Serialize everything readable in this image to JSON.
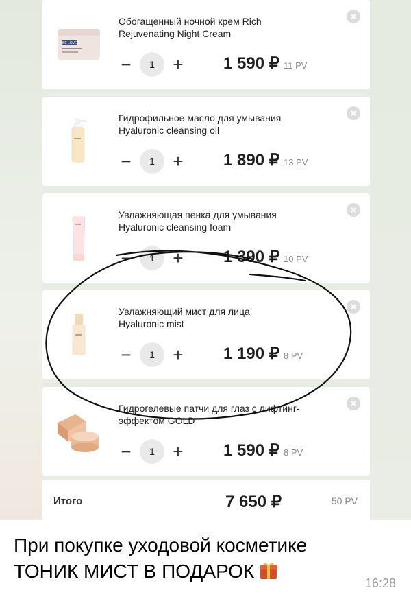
{
  "cart": {
    "items": [
      {
        "name_ru": "Обогащенный ночной крем Rich",
        "name_en": "Rejuvenating Night Cream",
        "qty": "1",
        "price": "1 590 ₽",
        "pv": "11 PV",
        "product_label": "BE LOVED"
      },
      {
        "name_ru": "Гидрофильное масло для умывания",
        "name_en": "Hyaluronic cleansing oil",
        "qty": "1",
        "price": "1 890 ₽",
        "pv": "13 PV"
      },
      {
        "name_ru": "Увлажняющая пенка для умывания",
        "name_en": "Hyaluronic cleansing foam",
        "qty": "1",
        "price": "1 390 ₽",
        "pv": "10 PV"
      },
      {
        "name_ru": "Увлажняющий мист для лица",
        "name_en": "Hyaluronic mist",
        "qty": "1",
        "price": "1 190 ₽",
        "pv": "8 PV"
      },
      {
        "name_ru": "Гидрогелевые патчи для глаз с лифтинг-",
        "name_en": "эффектом GOLD",
        "qty": "1",
        "price": "1 590 ₽",
        "pv": "8 PV"
      }
    ],
    "total_label": "Итого",
    "total_sum": "7 650 ₽",
    "total_pv": "50 PV"
  },
  "controls": {
    "minus": "−",
    "plus": "+"
  },
  "message": {
    "line1": "При покупке уходовой косметике",
    "line2": "ТОНИК МИСТ В ПОДАРОК",
    "time": "16:28"
  },
  "icons": {
    "remove": "close-circle-icon",
    "gift": "gift-icon"
  },
  "colors": {
    "card": "#ffffff",
    "background": "#e8ede4",
    "annotation": "#111111"
  }
}
